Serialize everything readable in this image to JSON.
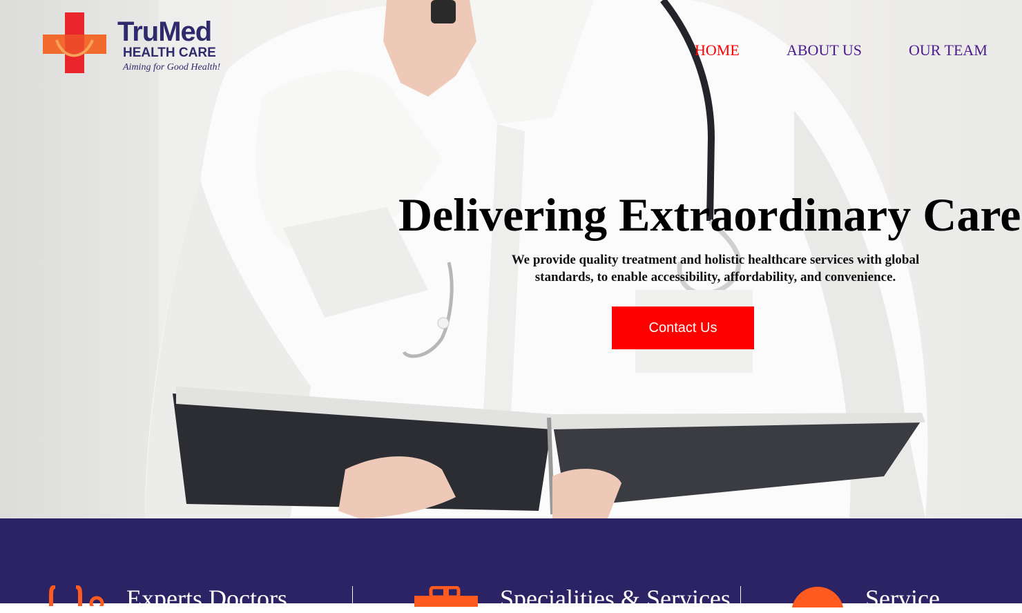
{
  "brand": {
    "name": "TruMed",
    "subtitle": "HEALTH CARE",
    "tagline": "Aiming for Good Health!"
  },
  "nav": {
    "items": [
      {
        "label": "HOME",
        "active": true
      },
      {
        "label": "ABOUT US",
        "active": false
      },
      {
        "label": "OUR TEAM",
        "active": false
      }
    ]
  },
  "hero": {
    "headline": "Delivering Extraordinary Care!",
    "description": "We provide quality treatment and holistic healthcare services with global standards, to enable accessibility, affordability, and convenience.",
    "cta_label": "Contact Us"
  },
  "features": [
    {
      "title": "Experts Doctors",
      "icon": "stethoscope-icon"
    },
    {
      "title": "Specialities & Services",
      "icon": "medical-bag-icon"
    },
    {
      "title": "Service",
      "icon": "service-icon"
    }
  ],
  "colors": {
    "brand_navy": "#2b2364",
    "accent_red": "#ff0000",
    "nav_purple": "#4b1b8c",
    "icon_orange": "#ff5a1f"
  }
}
